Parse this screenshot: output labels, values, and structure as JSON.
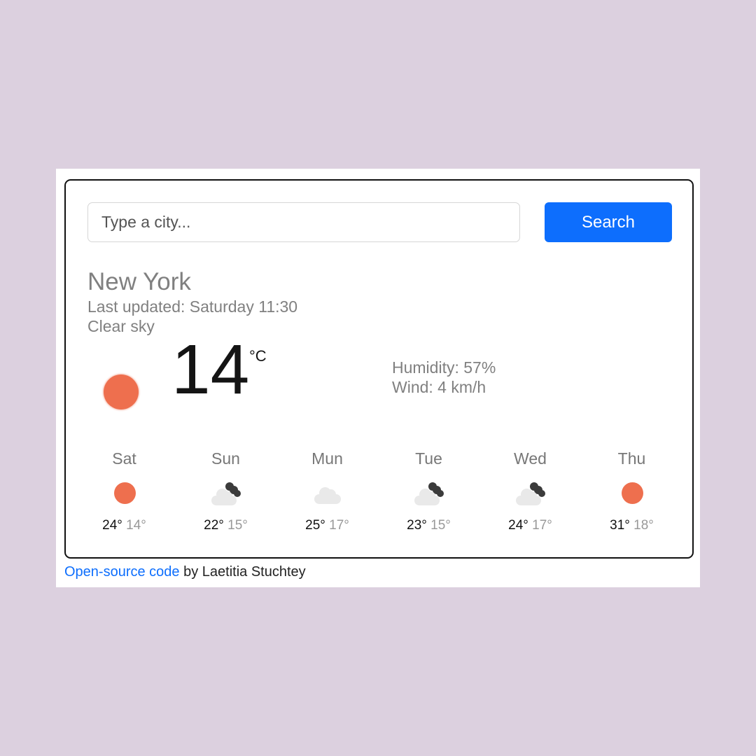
{
  "search": {
    "placeholder": "Type a city...",
    "button_label": "Search"
  },
  "current": {
    "city": "New York",
    "last_updated": "Last updated: Saturday 11:30",
    "description": "Clear sky",
    "temperature": "14",
    "unit": "°C",
    "humidity": "Humidity: 57%",
    "wind": "Wind: 4 km/h",
    "icon": "sun-icon"
  },
  "forecast": [
    {
      "day": "Sat",
      "max": "24°",
      "min": "14°",
      "icon": "sun-icon"
    },
    {
      "day": "Sun",
      "max": "22°",
      "min": "15°",
      "icon": "broken-clouds-icon"
    },
    {
      "day": "Mun",
      "max": "25°",
      "min": "17°",
      "icon": "cloud-icon"
    },
    {
      "day": "Tue",
      "max": "23°",
      "min": "15°",
      "icon": "broken-clouds-icon"
    },
    {
      "day": "Wed",
      "max": "24°",
      "min": "17°",
      "icon": "broken-clouds-icon"
    },
    {
      "day": "Thu",
      "max": "31°",
      "min": "18°",
      "icon": "sun-icon"
    }
  ],
  "footer": {
    "link_text": "Open-source code",
    "text": " by Laetitia Stuchtey"
  },
  "colors": {
    "background": "#dcd0df",
    "accent": "#0d6efd",
    "sun": "#ee6f4e"
  }
}
